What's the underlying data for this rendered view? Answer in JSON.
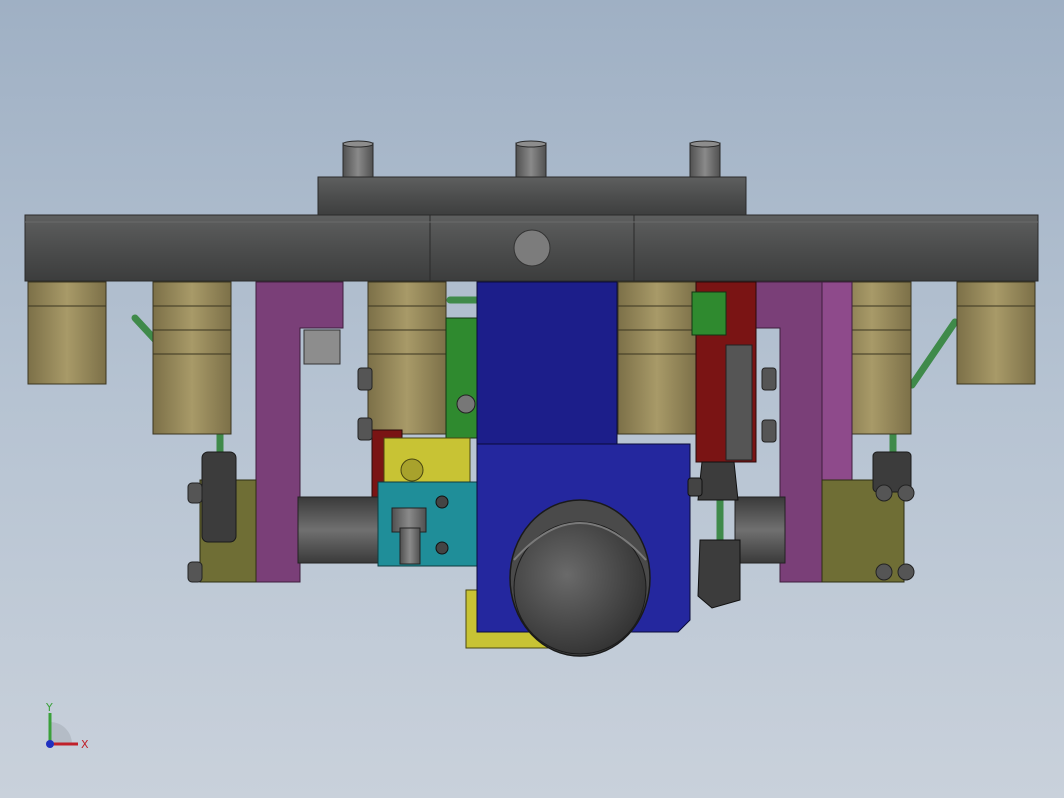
{
  "viewport": {
    "background_top": "#9fb0c4",
    "background_bottom": "#c9d1db"
  },
  "model": {
    "colors": {
      "frame": "#4f5050",
      "frame_dark": "#3a3b3b",
      "bushing": "#8a7d52",
      "bushing_light": "#a89a68",
      "purple": "#7a3f78",
      "purple_light": "#8e4a8b",
      "blue": "#1c1e8a",
      "blue_light": "#24279e",
      "green": "#2f8a2f",
      "olive": "#6f6e35",
      "cyan": "#1f8e99",
      "yellow": "#c8c334",
      "red": "#7a1414",
      "steel": "#6a6a6a",
      "pipe": "#3f8a4a"
    }
  },
  "triad": {
    "x_label": "X",
    "y_label": "Y",
    "x_color": "#c0202a",
    "y_color": "#3aa03a",
    "z_color": "#2030c0"
  }
}
